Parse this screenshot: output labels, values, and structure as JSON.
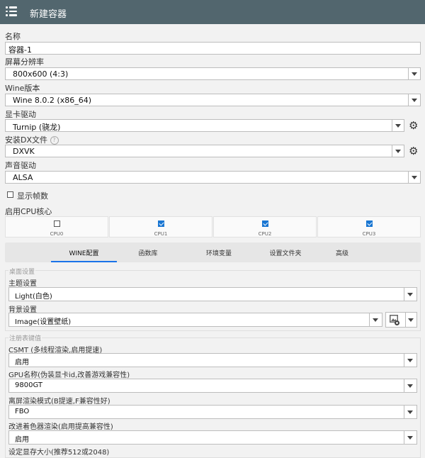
{
  "appbar": {
    "title": "新建容器"
  },
  "form": {
    "name_label": "名称",
    "name_value": "容器-1",
    "resolution_label": "屏幕分辨率",
    "resolution_value": "800x600 (4:3)",
    "wine_label": "Wine版本",
    "wine_value": "Wine 8.0.2 (x86_64)",
    "gpu_label": "显卡驱动",
    "gpu_value": "Turnip (骁龙)",
    "dx_label": "安装DX文件",
    "dx_value": "DXVK",
    "audio_label": "声音驱动",
    "audio_value": "ALSA",
    "show_fps_label": "显示帧数",
    "show_fps_checked": false,
    "cpu_label": "启用CPU核心",
    "cpus": [
      {
        "label": "CPU0",
        "checked": false
      },
      {
        "label": "CPU1",
        "checked": true
      },
      {
        "label": "CPU2",
        "checked": true
      },
      {
        "label": "CPU3",
        "checked": true
      }
    ]
  },
  "tabs": [
    "WINE配置",
    "函数库",
    "环境变量",
    "设置文件夹",
    "高级"
  ],
  "active_tab": "WINE配置",
  "desktop": {
    "group_label": "桌面设置",
    "theme_label": "主题设置",
    "theme_value": "Light(白色)",
    "bg_label": "背景设置",
    "bg_value": "Image(设置壁纸)"
  },
  "registry": {
    "group_label": "注册表键值",
    "csmt_label": "CSMT (多线程渲染,启用提速)",
    "csmt_value": "启用",
    "gpu_name_label": "GPU名称(伪装显卡id,改善游戏兼容性)",
    "gpu_name_value": "9800GT",
    "offscreen_label": "离屏渲染模式(B提速,F兼容性好)",
    "offscreen_value": "FBO",
    "shader_label": "改进着色器渲染(启用提高兼容性)",
    "shader_value": "启用",
    "vram_label": "设定显存大小(推荐512或2048)"
  },
  "icons": {
    "menu": "menu-icon",
    "gear": "gear-icon",
    "help": "help-icon",
    "image": "image-picker-icon"
  },
  "colors": {
    "appbar": "#52666e",
    "accent": "#1976d2"
  }
}
